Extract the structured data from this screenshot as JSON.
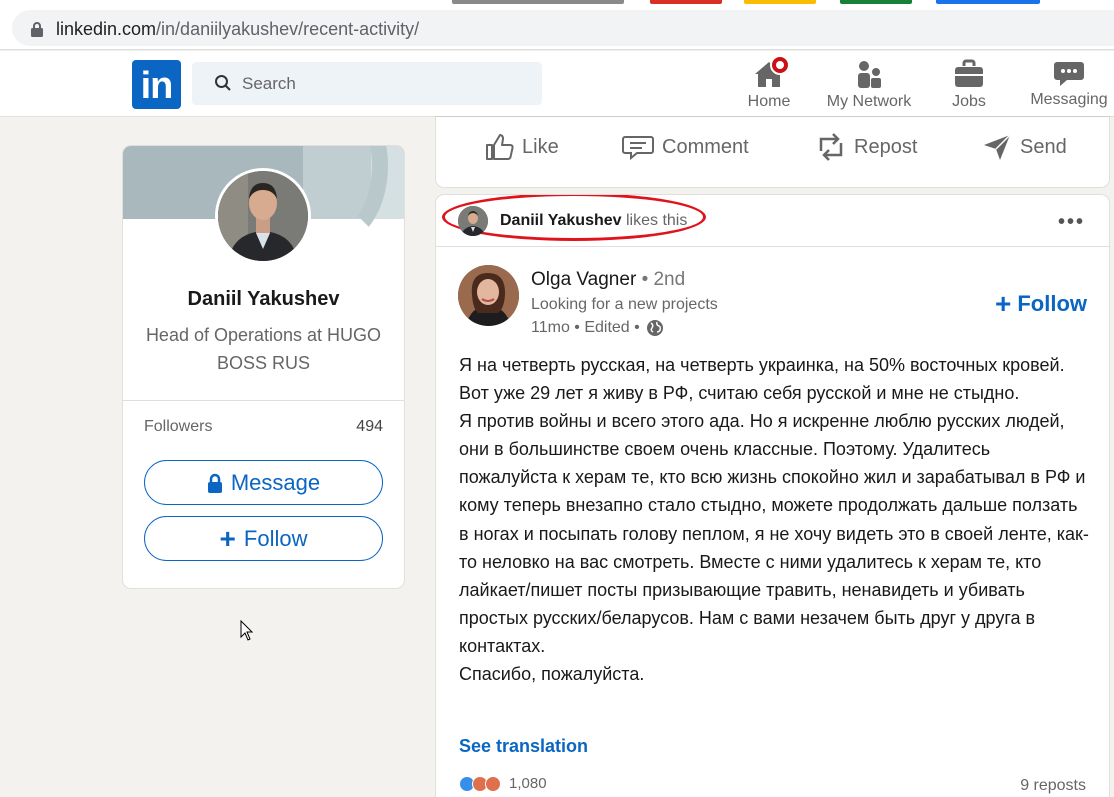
{
  "browser": {
    "url_domain": "linkedin.com",
    "url_path": "/in/daniilyakushev/recent-activity/"
  },
  "header": {
    "search_placeholder": "Search",
    "nav": [
      {
        "label": "Home",
        "icon": "home-icon"
      },
      {
        "label": "My Network",
        "icon": "network-icon"
      },
      {
        "label": "Jobs",
        "icon": "briefcase-icon"
      },
      {
        "label": "Messaging",
        "icon": "messaging-icon"
      }
    ]
  },
  "profile": {
    "name": "Daniil Yakushev",
    "headline": "Head of Operations at HUGO BOSS RUS",
    "followers_label": "Followers",
    "followers_count": "494",
    "message_label": "Message",
    "follow_label": "Follow"
  },
  "action_bar": {
    "like": "Like",
    "comment": "Comment",
    "repost": "Repost",
    "send": "Send"
  },
  "post": {
    "liked_by": "Daniil Yakushev",
    "liked_suffix": "likes this",
    "author": {
      "name": "Olga Vagner",
      "degree": "• 2nd",
      "headline": "Looking for a new projects",
      "meta": "11mo • Edited •"
    },
    "follow_label": "Follow",
    "paragraphs": [
      "Я на четверть русская, на четверть украинка, на 50% восточных кровей. Вот уже 29 лет я живу в РФ, считаю себя русской и мне не стыдно.",
      "Я против войны и всего этого ада. Но я искренне люблю русских людей, они в большинстве своем очень классные. Поэтому. Удалитесь пожалуйста к херам те, кто всю жизнь спокойно жил и зарабатывал в РФ и кому теперь внезапно стало стыдно, можете продолжать дальше ползать в ногах и посыпать голову пеплом, я не хочу видеть это в своей ленте, как-то неловко на вас смотреть. Вместе с ними удалитесь к херам те, кто лайкает/пишет посты призывающие травить, ненавидеть и убивать простых русских/беларусов. Нам с вами незачем быть друг у друга в контактах.",
      "Спасибо, пожалуйста."
    ],
    "see_translation": "See translation",
    "reaction_count": "1,080",
    "reposts": "9 reposts"
  },
  "colors": {
    "brand": "#0a66c2",
    "highlight_ring": "#e0121a",
    "notification": "#cc1016"
  }
}
